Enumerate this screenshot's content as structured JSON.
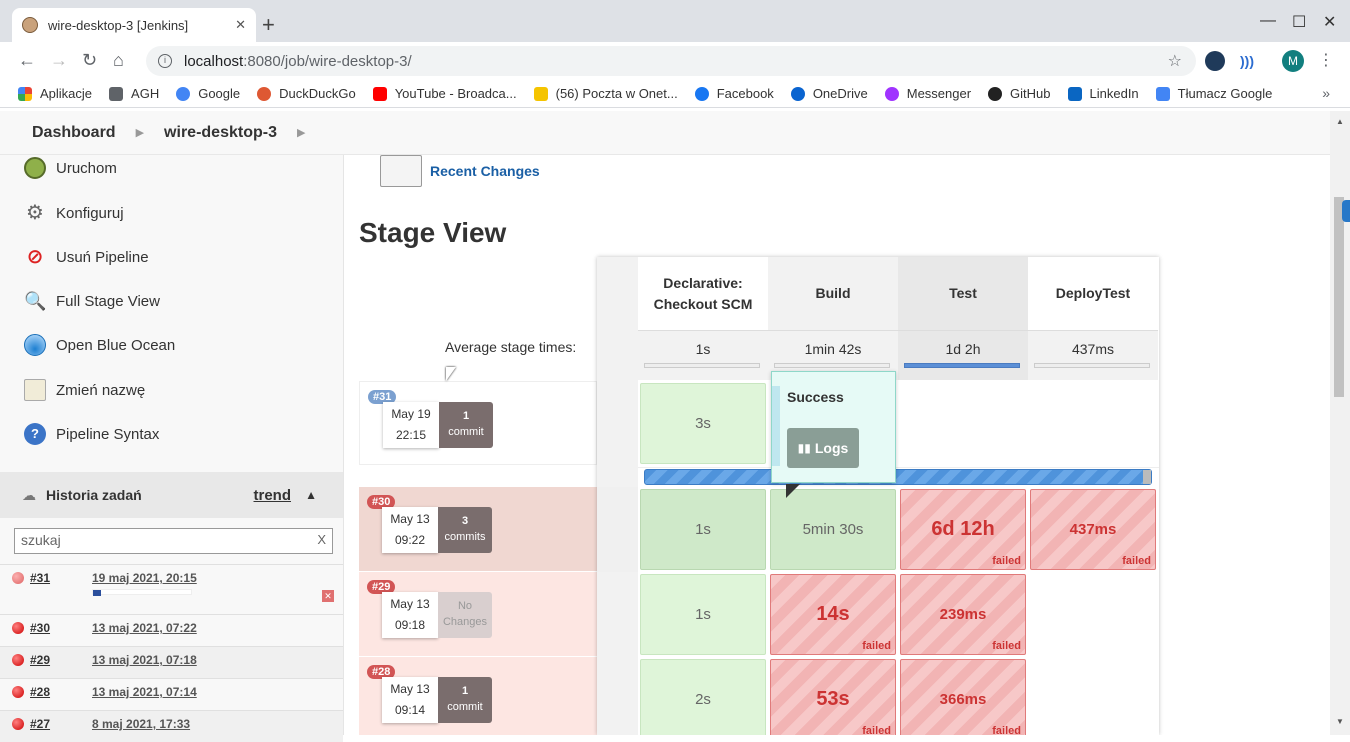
{
  "browser": {
    "tab_title": "wire-desktop-3 [Jenkins]",
    "url_host": "localhost",
    "url_path": ":8080/job/wire-desktop-3/",
    "avatar_letter": "M"
  },
  "bookmarks": [
    {
      "label": "Aplikacje",
      "icon": "apps-grid-icon",
      "color": "#e8453c"
    },
    {
      "label": "AGH",
      "icon": "folder-icon",
      "color": "#5f6368"
    },
    {
      "label": "Google",
      "icon": "google-icon",
      "color": "#4285f4"
    },
    {
      "label": "DuckDuckGo",
      "icon": "duckduckgo-icon",
      "color": "#de5833"
    },
    {
      "label": "YouTube - Broadca...",
      "icon": "youtube-icon",
      "color": "#ff0000"
    },
    {
      "label": "(56) Poczta w Onet...",
      "icon": "onet-mail-icon",
      "color": "#f5c400"
    },
    {
      "label": "Facebook",
      "icon": "facebook-icon",
      "color": "#1877f2"
    },
    {
      "label": "OneDrive",
      "icon": "onedrive-icon",
      "color": "#0a64d0"
    },
    {
      "label": "Messenger",
      "icon": "messenger-icon",
      "color": "#a033ff"
    },
    {
      "label": "GitHub",
      "icon": "github-icon",
      "color": "#222222"
    },
    {
      "label": "LinkedIn",
      "icon": "linkedin-icon",
      "color": "#0a66c2"
    },
    {
      "label": "Tłumacz Google",
      "icon": "translate-icon",
      "color": "#4285f4"
    }
  ],
  "breadcrumb": {
    "dashboard": "Dashboard",
    "job": "wire-desktop-3"
  },
  "sidebar": {
    "items": [
      {
        "label": "Uruchom",
        "icon": "clock-run-icon"
      },
      {
        "label": "Konfiguruj",
        "icon": "gear-icon"
      },
      {
        "label": "Usuń Pipeline",
        "icon": "no-entry-icon"
      },
      {
        "label": "Full Stage View",
        "icon": "magnifier-icon"
      },
      {
        "label": "Open Blue Ocean",
        "icon": "blue-ocean-icon"
      },
      {
        "label": "Zmień nazwę",
        "icon": "notepad-icon"
      },
      {
        "label": "Pipeline Syntax",
        "icon": "help-icon"
      }
    ],
    "history": {
      "title": "Historia zadań",
      "trend": "trend",
      "search_value": "szukaj",
      "builds": [
        {
          "num": "#31",
          "date": "19 maj 2021, 20:15"
        },
        {
          "num": "#30",
          "date": "13 maj 2021, 07:22"
        },
        {
          "num": "#29",
          "date": "13 maj 2021, 07:18"
        },
        {
          "num": "#28",
          "date": "13 maj 2021, 07:14"
        },
        {
          "num": "#27",
          "date": "8 maj 2021, 17:33"
        }
      ]
    }
  },
  "main": {
    "recent_changes": "Recent Changes",
    "stage_view_title": "Stage View",
    "avg_label": "Average stage times:",
    "stages": [
      {
        "name": "Declarative: Checkout SCM",
        "avg": "1s"
      },
      {
        "name": "Build",
        "avg": "1min 42s"
      },
      {
        "name": "Test",
        "avg": "1d 2h"
      },
      {
        "name": "DeployTest",
        "avg": "437ms"
      }
    ],
    "runs": [
      {
        "badge": "#31",
        "date": "May 19",
        "time": "22:15",
        "commits_n": "1",
        "commits_w": "commit",
        "cells": [
          "3s",
          "",
          "",
          ""
        ]
      },
      {
        "badge": "#30",
        "date": "May 13",
        "time": "09:22",
        "commits_n": "3",
        "commits_w": "commits",
        "cells": [
          "1s",
          "5min 30s",
          "6d 12h",
          "437ms"
        ]
      },
      {
        "badge": "#29",
        "date": "May 13",
        "time": "09:18",
        "commits_n": "No",
        "commits_w": "Changes",
        "cells": [
          "1s",
          "14s",
          "239ms",
          ""
        ]
      },
      {
        "badge": "#28",
        "date": "May 13",
        "time": "09:14",
        "commits_n": "1",
        "commits_w": "commit",
        "cells": [
          "2s",
          "53s",
          "366ms",
          ""
        ]
      }
    ],
    "failed_tag": "failed",
    "popup": {
      "title": "Success",
      "logs": "Logs"
    }
  },
  "colors": {
    "accent_link": "#1a5fa5",
    "fail": "#cc3333",
    "success": "#dff5d9"
  }
}
